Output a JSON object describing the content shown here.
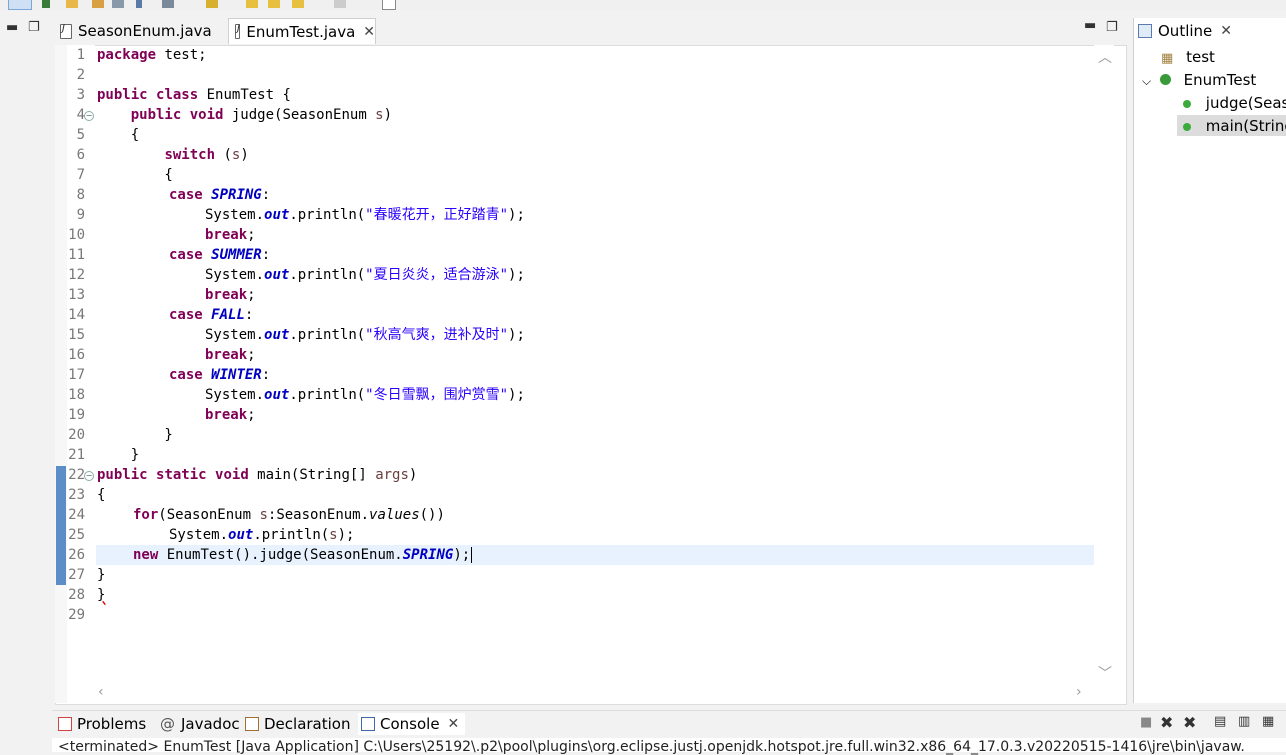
{
  "editor": {
    "tabs": [
      {
        "label": "SeasonEnum.java"
      },
      {
        "label": "EnumTest.java"
      }
    ],
    "line_numbers": [
      "1",
      "2",
      "3",
      "4",
      "5",
      "6",
      "7",
      "8",
      "9",
      "10",
      "11",
      "12",
      "13",
      "14",
      "15",
      "16",
      "17",
      "18",
      "19",
      "20",
      "21",
      "22",
      "23",
      "24",
      "25",
      "26",
      "27",
      "28",
      "29"
    ],
    "code": {
      "l1_a": "package",
      "l1_b": " test;",
      "l3_a": "public",
      "l3_b": " ",
      "l3_c": "class",
      "l3_d": " EnumTest {",
      "l4_indent": "    ",
      "l4_a": "public",
      "l4_b": " ",
      "l4_c": "void",
      "l4_d": " judge(SeasonEnum ",
      "l4_e": "s",
      "l4_f": ")",
      "l5": "    {",
      "l6_indent": "        ",
      "l6_a": "switch",
      "l6_b": " (",
      "l6_c": "s",
      "l6_d": ")",
      "l7": "        {",
      "case_kw": "case",
      "break_kw": "break",
      "sys": "System.",
      "out": "out",
      "println": ".println(",
      "close": ");",
      "semi": ";",
      "colon": ":",
      "spring": "SPRING",
      "summer": "SUMMER",
      "fall": "FALL",
      "winter": "WINTER",
      "str_spring": "\"春暖花开，正好踏青\"",
      "str_summer": "\"夏日炎炎，适合游泳\"",
      "str_fall": "\"秋高气爽，进补及时\"",
      "str_winter": "\"冬日雪飘，围炉赏雪\"",
      "l20": "        }",
      "l21": "    }",
      "l22_a": "public",
      "l22_b": " ",
      "l22_c": "static",
      "l22_d": " ",
      "l22_e": "void",
      "l22_f": " main(String[] ",
      "l22_g": "args",
      "l22_h": ")",
      "l23": "{",
      "l24_a": "for",
      "l24_b": "(SeasonEnum ",
      "l24_c": "s",
      "l24_d": ":SeasonEnum.",
      "l24_e": "values",
      "l24_f": "())",
      "l25_a": "System.",
      "l25_b": "out",
      "l25_c": ".println(",
      "l25_d": "s",
      "l25_e": ");",
      "l26_a": "new",
      "l26_b": " EnumTest().judge(SeasonEnum.",
      "l26_c": "SPRING",
      "l26_d": ");",
      "l27": "}",
      "l28": "}"
    }
  },
  "outline": {
    "title": "Outline",
    "items": [
      {
        "label": "test"
      },
      {
        "label": "EnumTest"
      },
      {
        "label": "judge(Seas"
      },
      {
        "label": "main(String"
      }
    ]
  },
  "bottom": {
    "tabs": [
      {
        "label": "Problems"
      },
      {
        "label": "Javadoc"
      },
      {
        "label": "Declaration"
      },
      {
        "label": "Console"
      }
    ],
    "console_text": "<terminated> EnumTest [Java Application] C:\\Users\\25192\\.p2\\pool\\plugins\\org.eclipse.justj.openjdk.hotspot.jre.full.win32.x86_64_17.0.3.v20220515-1416\\jre\\bin\\javaw."
  },
  "colors": {
    "keyword": "#7f0055",
    "field": "#0000c0",
    "string": "#2a00ff",
    "current_line": "#e8f2fe"
  }
}
